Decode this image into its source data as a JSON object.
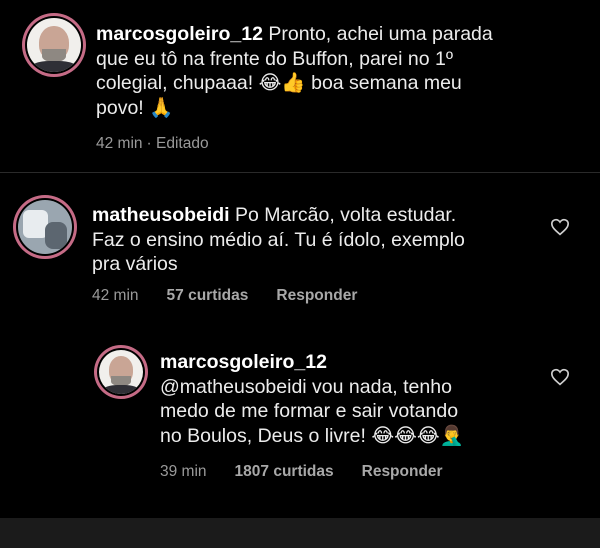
{
  "comments": [
    {
      "username": "marcosgoleiro_12",
      "text_lines": [
        "Pronto, achei uma parada",
        "que eu tô na frente do Buffon, parei no 1º",
        "colegial, chupaaa! 😂👍 boa semana meu",
        "povo! 🙏"
      ],
      "time": "42 min",
      "edited": "· Editado"
    },
    {
      "username": "matheusobeidi",
      "text_lines": [
        "Po Marcão, volta estudar.",
        "Faz o ensino médio aí. Tu é ídolo, exemplo",
        "pra vários"
      ],
      "time": "42 min",
      "likes": "57 curtidas",
      "reply": "Responder"
    },
    {
      "username": "marcosgoleiro_12",
      "text_lines": [
        "@matheusobeidi vou nada, tenho",
        "medo de me formar e sair votando",
        "no Boulos, Deus o livre! 😂😂😂🤦‍♂️"
      ],
      "time": "39 min",
      "likes": "1807 curtidas",
      "reply": "Responder"
    }
  ],
  "colors": {
    "background": "#000000",
    "text": "#ececec",
    "meta": "#9a9a9a",
    "story_ring": "#c56b86"
  },
  "icons": {
    "like": "heart-outline-icon"
  }
}
